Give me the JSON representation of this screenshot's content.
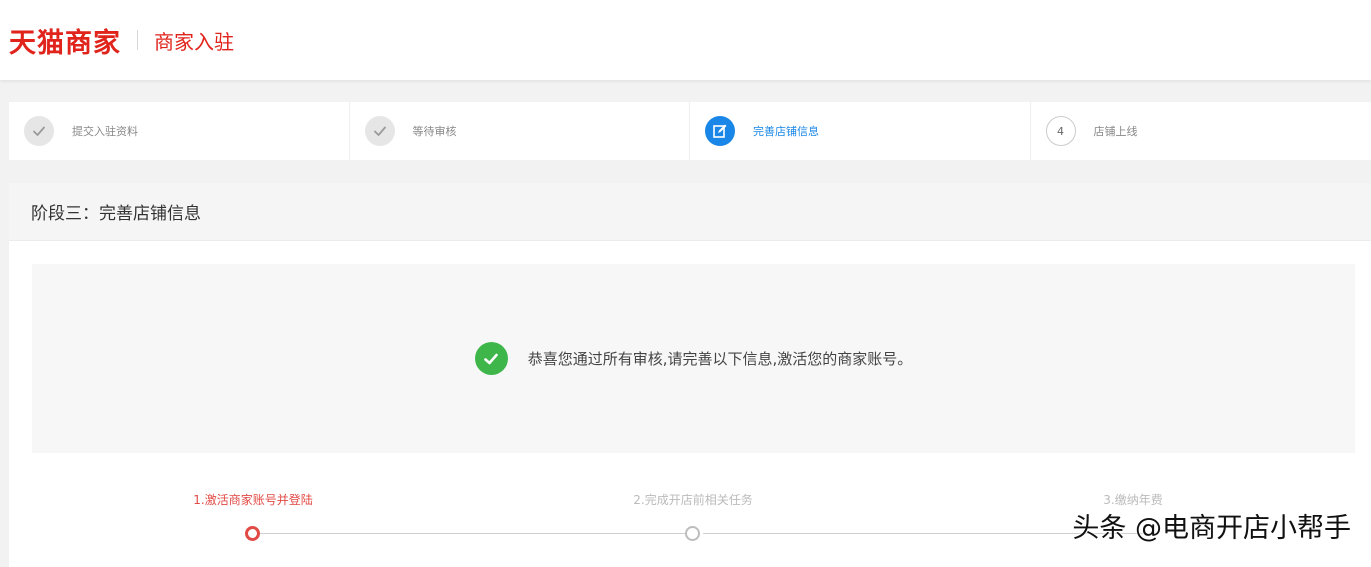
{
  "header": {
    "logo": "天猫商家",
    "subtitle": "商家入驻"
  },
  "steps": [
    {
      "label": "提交入驻资料",
      "state": "done"
    },
    {
      "label": "等待审核",
      "state": "done"
    },
    {
      "label": "完善店铺信息",
      "state": "active"
    },
    {
      "label": "店铺上线",
      "state": "todo",
      "number": "4"
    }
  ],
  "stage": {
    "title": "阶段三：完善店铺信息",
    "notice": "恭喜您通过所有审核,请完善以下信息,激活您的商家账号。"
  },
  "progress": [
    {
      "label": "1.激活商家账号并登陆",
      "state": "active"
    },
    {
      "label": "2.完成开店前相关任务",
      "state": "todo"
    },
    {
      "label": "3.缴纳年费",
      "state": "todo"
    }
  ],
  "watermark": "头条 @电商开店小帮手",
  "colors": {
    "brand": "#e0231b",
    "active_step": "#1a87e8",
    "success": "#3fb64a",
    "progress_active": "#e24a45"
  },
  "icons": {
    "done_step": "check-icon",
    "active_step": "edit-icon",
    "notice": "check-circle-icon"
  }
}
